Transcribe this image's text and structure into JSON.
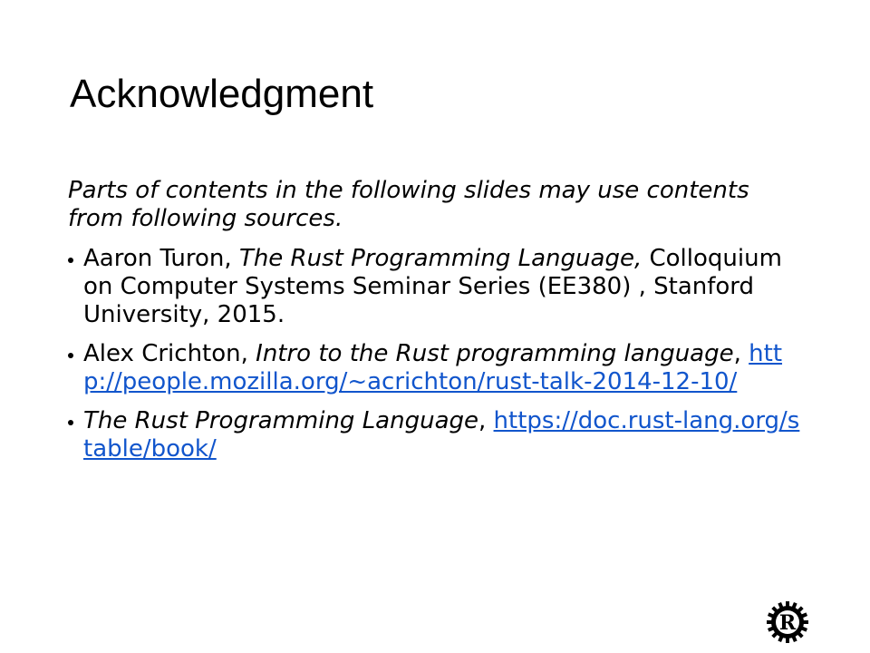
{
  "slide": {
    "title": "Acknowledgment",
    "intro": "Parts of contents in the following slides may use contents from following sources.",
    "bullets": [
      {
        "author": "Aaron Turon, ",
        "work": "The Rust Programming Language,",
        "rest": " Colloquium on Computer Systems Seminar Series (EE380) , Stanford University, 2015."
      },
      {
        "author": "Alex Crichton, ",
        "work": "Intro to the Rust programming language",
        "sep": ", ",
        "link": "http://people.mozilla.org/~acrichton/rust-talk-2014-12-10/"
      },
      {
        "work": "The Rust Programming Language",
        "sep": ", ",
        "link": "https://doc.rust-lang.org/stable/book/"
      }
    ]
  },
  "logo": {
    "icon": "rust-logo-icon",
    "letter": "R"
  },
  "colors": {
    "link": "#1155cc",
    "text": "#000000",
    "background": "#ffffff"
  }
}
